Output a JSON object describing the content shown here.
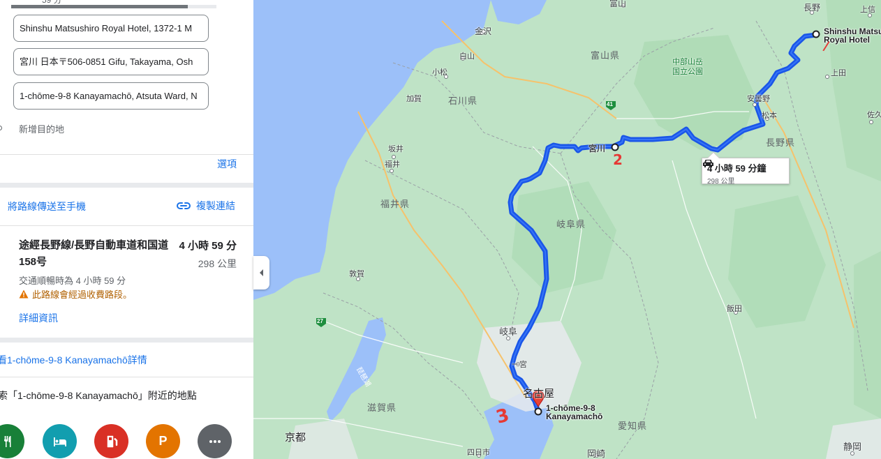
{
  "panel": {
    "top_clipped_text": "59 分",
    "progress": 0.86,
    "waypoints": [
      {
        "value": "Shinshu Matsushiro Royal Hotel, 1372-1 M"
      },
      {
        "value": "宮川 日本〒506-0851 Gifu, Takayama, Osh"
      },
      {
        "value": "1-chōme-9-8 Kanayamachō, Atsuta Ward, N"
      }
    ],
    "add_destination": "新增目的地",
    "options_link": "選項",
    "send_to_phone": "將路線傳送至手機",
    "copy_link": "複製連結",
    "route": {
      "name": "途經長野線/長野自動車道和国道158号",
      "time": "4 小時 59 分",
      "distance": "298 公里",
      "traffic": "交通順暢時為 4 小時 59 分",
      "warning": "此路線會經過收費路段。",
      "details": "詳細資訊"
    },
    "destination_details": "看1-chōme-9-8 Kanayamachō詳情",
    "nearby_search": "索「1-chōme-9-8 Kanayamachō」附近的地點",
    "categories": [
      {
        "icon": "restaurant-icon",
        "color": "#188038"
      },
      {
        "icon": "hotel-icon",
        "color": "#129eaf"
      },
      {
        "icon": "gas-station-icon",
        "color": "#d93025"
      },
      {
        "icon": "parking-icon",
        "color": "#e37400",
        "glyph": "P"
      },
      {
        "icon": "more-icon",
        "color": "#5f6368"
      }
    ]
  },
  "map": {
    "route_color": "#1a56e8",
    "callout": {
      "time": "4 小時 59 分鐘",
      "distance": "298 公里"
    },
    "origin_label": [
      "Shinshu Matsushiro",
      "Royal Hotel"
    ],
    "destination_label": [
      "1-chōme-9-8",
      "Kanayamachō"
    ],
    "annotations": [
      "/",
      "2",
      "3"
    ],
    "labels": {
      "toyama_city": "富山",
      "nagano_city": "長野",
      "kanazawa": "金沢",
      "toyama_pref": "富山県",
      "ishikawa_pref": "石川県",
      "komatsu": "小松",
      "hakusan": "白山",
      "kaga": "加賀",
      "chubu_park": "中部山岳\n国立公園",
      "ueda": "上田",
      "azumino": "安曇野",
      "matsumoto": "松本",
      "nagano_pref": "長野県",
      "sakae": "坂井",
      "fukui": "福井",
      "fukui_pref": "福井県",
      "miyagawa": "宮川",
      "gifu_pref": "岐阜県",
      "tsuruga": "敦賀",
      "gifu": "岐阜",
      "ichinomiya": "一宮",
      "nagoya": "名古屋",
      "shiga_pref": "滋賀県",
      "kyoto": "京都",
      "aichi_pref": "愛知県",
      "iida": "飯田",
      "yokkaichi": "四日市",
      "okazaki": "岡崎",
      "shizuoka": "静岡",
      "biwako": "琵琶湖",
      "saku": "佐久",
      "shinetsu": "上信",
      "route41": "41",
      "route27": "27"
    }
  }
}
